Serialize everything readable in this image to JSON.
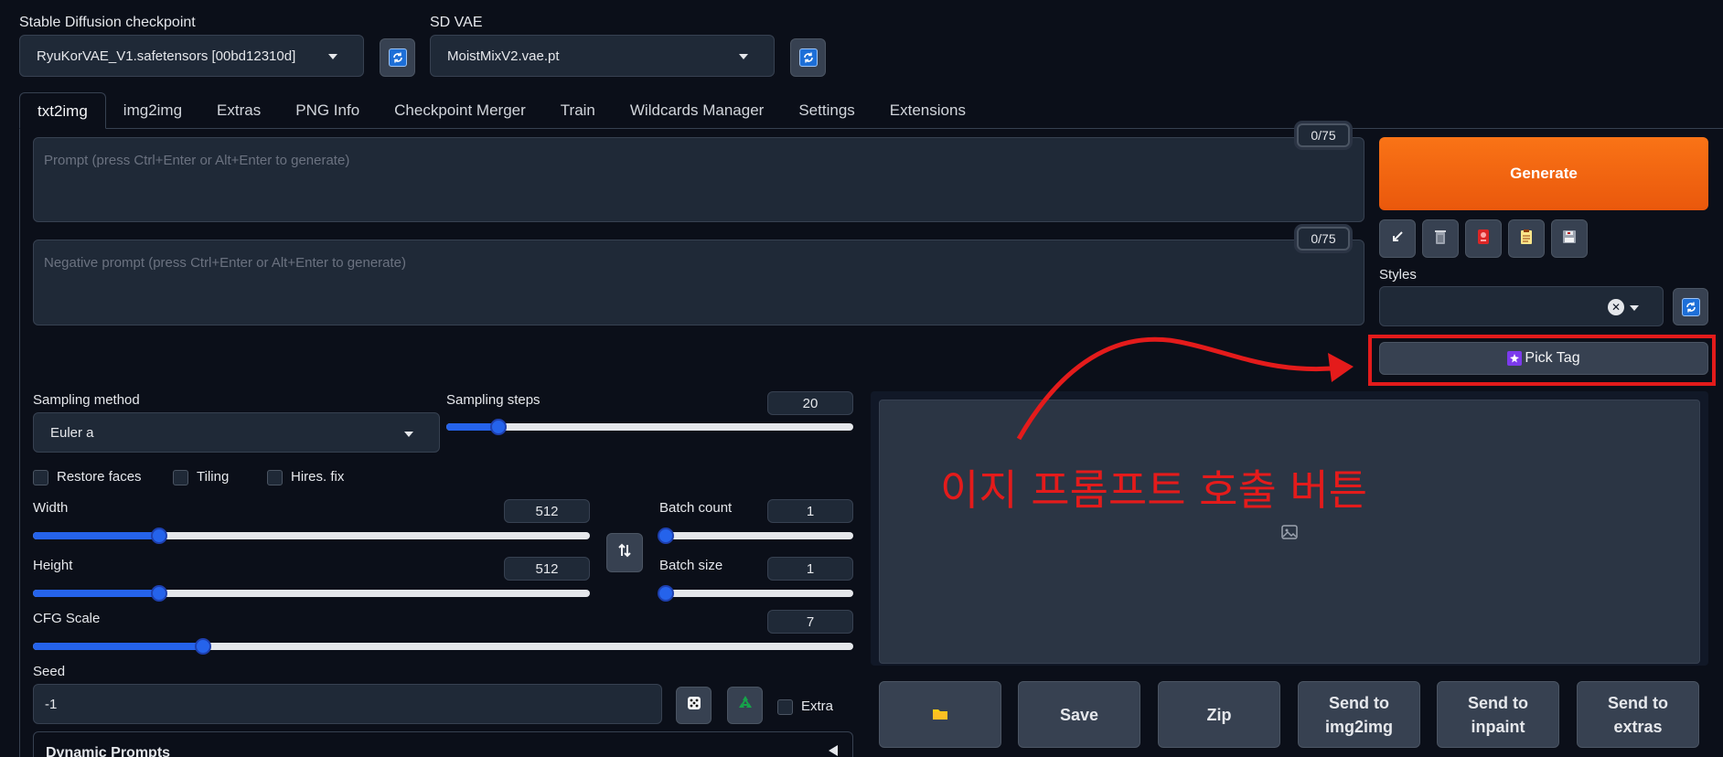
{
  "checkpoint": {
    "label": "Stable Diffusion checkpoint",
    "value": "RyuKorVAE_V1.safetensors [00bd12310d]"
  },
  "vae": {
    "label": "SD VAE",
    "value": "MoistMixV2.vae.pt"
  },
  "tabs": [
    {
      "label": "txt2img",
      "active": true
    },
    {
      "label": "img2img"
    },
    {
      "label": "Extras"
    },
    {
      "label": "PNG Info"
    },
    {
      "label": "Checkpoint Merger"
    },
    {
      "label": "Train"
    },
    {
      "label": "Wildcards Manager"
    },
    {
      "label": "Settings"
    },
    {
      "label": "Extensions"
    }
  ],
  "prompt": {
    "placeholder": "Prompt (press Ctrl+Enter or Alt+Enter to generate)",
    "counter": "0/75"
  },
  "negative_prompt": {
    "placeholder": "Negative prompt (press Ctrl+Enter or Alt+Enter to generate)",
    "counter": "0/75"
  },
  "generate_label": "Generate",
  "tool_icons": [
    "arrow-icon",
    "trash-icon",
    "red-card-icon",
    "clipboard-icon",
    "save-disk-icon"
  ],
  "styles": {
    "label": "Styles",
    "clear_glyph": "✕"
  },
  "pick_tag_label": "Pick Tag",
  "sampling": {
    "method_label": "Sampling method",
    "method_value": "Euler a",
    "steps_label": "Sampling steps",
    "steps_value": "20",
    "steps_min": 1,
    "steps_max": 150
  },
  "checkboxes": [
    "Restore faces",
    "Tiling",
    "Hires. fix"
  ],
  "width": {
    "label": "Width",
    "value": "512",
    "min": 64,
    "max": 2048
  },
  "height": {
    "label": "Height",
    "value": "512",
    "min": 64,
    "max": 2048
  },
  "batch_count": {
    "label": "Batch count",
    "value": "1"
  },
  "batch_size": {
    "label": "Batch size",
    "value": "1"
  },
  "cfg": {
    "label": "CFG Scale",
    "value": "7",
    "min": 1,
    "max": 30
  },
  "seed": {
    "label": "Seed",
    "value": "-1",
    "extra_label": "Extra"
  },
  "dynamic_prompts_label": "Dynamic Prompts",
  "annotation_text": "이지 프롬프트 호출 버튼",
  "gallery_buttons": [
    {
      "label": "",
      "icon": "folder-icon"
    },
    {
      "label": "Save"
    },
    {
      "label": "Zip"
    },
    {
      "label": "Send to img2img"
    },
    {
      "label": "Send to inpaint"
    },
    {
      "label": "Send to extras"
    }
  ],
  "colors": {
    "accent": "#f97316",
    "slider": "#2563eb",
    "annotation": "#e41b1b"
  }
}
